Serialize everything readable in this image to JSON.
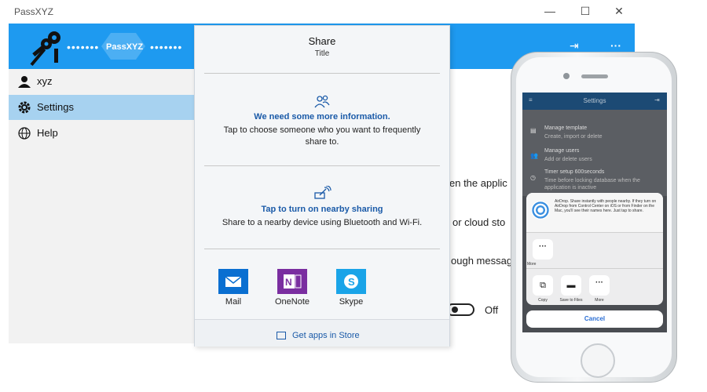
{
  "window": {
    "app_title": "PassXYZ",
    "minimize_glyph": "—",
    "maximize_glyph": "☐",
    "close_glyph": "✕"
  },
  "header": {
    "masked_1": "•••••••",
    "masked_2": "•••••••",
    "pill_label": "PassXYZ",
    "more_glyph": "···",
    "bg_color": "#1e9af0"
  },
  "sidebar": {
    "items": [
      {
        "label": "xyz",
        "icon": "user-icon"
      },
      {
        "label": "Settings",
        "icon": "gear-icon"
      },
      {
        "label": "Help",
        "icon": "globe-icon"
      }
    ],
    "active_color": "#a7d2f0"
  },
  "main": {
    "frag_1": "en the applic",
    "frag_2": "or cloud sto",
    "frag_3": "ough messag",
    "toggle_state": "Off"
  },
  "share": {
    "title": "Share",
    "subtitle": "Title",
    "section1_heading": "We need some more information.",
    "section1_desc_line1": "Tap to choose someone who you want to frequently",
    "section1_desc_line2": "share to.",
    "section2_heading": "Tap to turn on nearby sharing",
    "section2_desc": "Share to a nearby device using Bluetooth and Wi-Fi.",
    "apps": [
      {
        "label": "Mail",
        "icon": "mail-icon",
        "color": "#0a6fd1"
      },
      {
        "label": "OneNote",
        "icon": "onenote-icon",
        "color": "#7a2ea0"
      },
      {
        "label": "Skype",
        "icon": "skype-icon",
        "color": "#1aa4e8"
      }
    ],
    "store_link": "Get apps in Store"
  },
  "phone": {
    "nav_title": "Settings",
    "rows": [
      {
        "title": "Manage template",
        "sub": "Create, import or delete"
      },
      {
        "title": "Manage users",
        "sub": "Add or delete users"
      },
      {
        "title": "Timer setup 600seconds",
        "sub": "Time before locking database when the",
        "sub2": "application is inactive"
      }
    ],
    "airdrop_text": "AirDrop. Share instantly with people nearby. If they turn on AirDrop from Control Center on iOS or from Finder on the Mac, you'll see their names here. Just tap to share.",
    "more_label": "More",
    "actions": [
      {
        "label": "Copy",
        "icon": "copy-icon"
      },
      {
        "label": "Save to Files",
        "icon": "folder-icon"
      },
      {
        "label": "More",
        "icon": "more-icon"
      }
    ],
    "cancel_label": "Cancel"
  }
}
